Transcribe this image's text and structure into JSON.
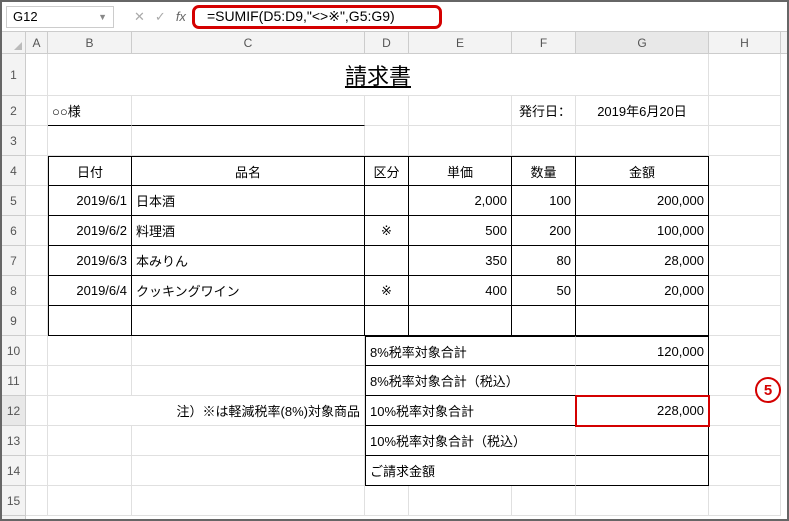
{
  "namebox": {
    "value": "G12"
  },
  "formula": "=SUMIF(D5:D9,\"<>※\",G5:G9)",
  "columns": [
    "A",
    "B",
    "C",
    "D",
    "E",
    "F",
    "G",
    "H"
  ],
  "rows": [
    "1",
    "2",
    "3",
    "4",
    "5",
    "6",
    "7",
    "8",
    "9",
    "10",
    "11",
    "12",
    "13",
    "14",
    "15"
  ],
  "title": "請求書",
  "customer": "○○様",
  "issue_label": "発行日：",
  "issue_date": "2019年6月20日",
  "headers": {
    "date": "日付",
    "item": "品名",
    "cls": "区分",
    "unit": "単価",
    "qty": "数量",
    "amount": "金額"
  },
  "lines": [
    {
      "date": "2019/6/1",
      "item": "日本酒",
      "cls": "",
      "unit": "2,000",
      "qty": "100",
      "amount": "200,000"
    },
    {
      "date": "2019/6/2",
      "item": "料理酒",
      "cls": "※",
      "unit": "500",
      "qty": "200",
      "amount": "100,000"
    },
    {
      "date": "2019/6/3",
      "item": "本みりん",
      "cls": "",
      "unit": "350",
      "qty": "80",
      "amount": "28,000"
    },
    {
      "date": "2019/6/4",
      "item": "クッキングワイン",
      "cls": "※",
      "unit": "400",
      "qty": "50",
      "amount": "20,000"
    }
  ],
  "note": "注）※は軽減税率(8%)対象商品",
  "totals": {
    "t8": "8%税率対象合計",
    "t8v": "120,000",
    "t8inc": "8%税率対象合計（税込）",
    "t10": "10%税率対象合計",
    "t10v": "228,000",
    "t10inc": "10%税率対象合計（税込）",
    "grand": "ご請求金額"
  },
  "callout": "5",
  "chart_data": {
    "type": "table",
    "title": "請求書",
    "columns": [
      "日付",
      "品名",
      "区分",
      "単価",
      "数量",
      "金額"
    ],
    "rows": [
      [
        "2019/6/1",
        "日本酒",
        "",
        2000,
        100,
        200000
      ],
      [
        "2019/6/2",
        "料理酒",
        "※",
        500,
        200,
        100000
      ],
      [
        "2019/6/3",
        "本みりん",
        "",
        350,
        80,
        28000
      ],
      [
        "2019/6/4",
        "クッキングワイン",
        "※",
        400,
        50,
        20000
      ]
    ],
    "totals": {
      "8%税率対象合計": 120000,
      "10%税率対象合計": 228000
    },
    "formula_cell": "G12",
    "formula": "=SUMIF(D5:D9,\"<>※\",G5:G9)"
  }
}
